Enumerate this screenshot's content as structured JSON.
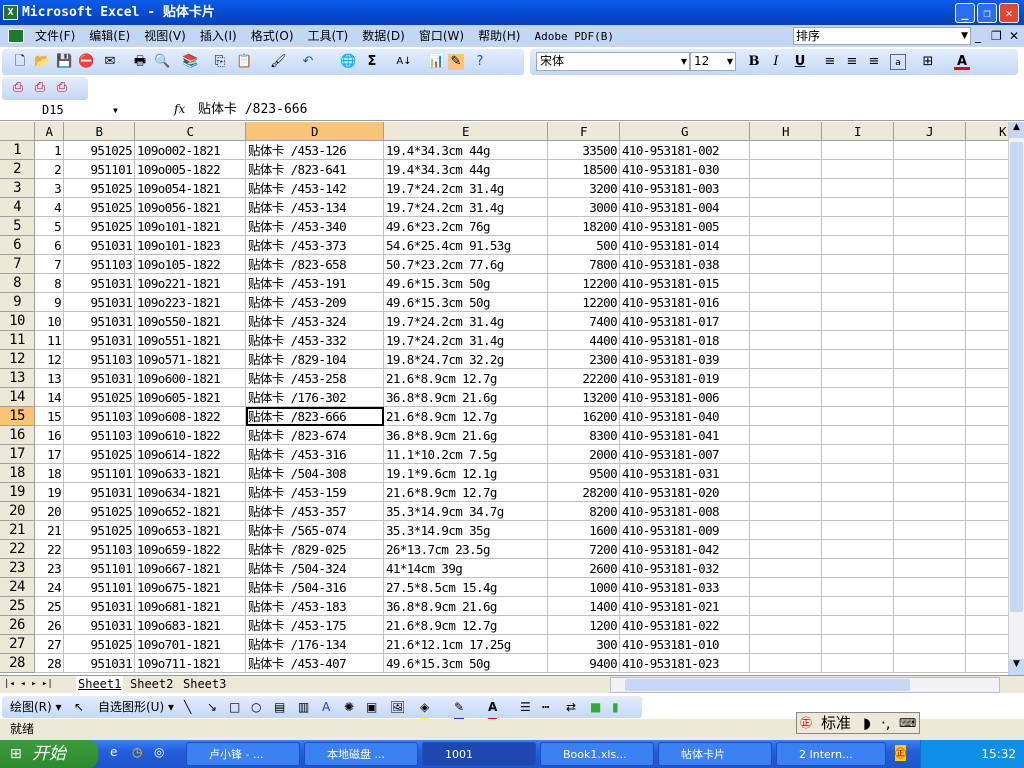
{
  "window": {
    "title": "Microsoft Excel - 贴体卡片",
    "minimize": "_",
    "restore": "❐",
    "close": "✕"
  },
  "menu": {
    "items": [
      "文件(F)",
      "编辑(E)",
      "视图(V)",
      "插入(I)",
      "格式(O)",
      "工具(T)",
      "数据(D)",
      "窗口(W)",
      "帮助(H)",
      "Adobe PDF(B)"
    ],
    "help_box": "排序"
  },
  "format_toolbar": {
    "font": "宋体",
    "size": "12",
    "bold": "B",
    "italic": "I",
    "underline": "U"
  },
  "formula_bar": {
    "name_box": "D15",
    "fx": "fx",
    "content": "贴体卡 /823-666"
  },
  "grid": {
    "columns": [
      "A",
      "B",
      "C",
      "D",
      "E",
      "F",
      "G",
      "H",
      "I",
      "J",
      "K"
    ],
    "selected_cell": "D15",
    "rows": [
      [
        "1",
        "951025",
        "109o002-1821",
        "贴体卡 /453-126",
        "19.4*34.3cm 44g",
        "33500",
        "410-953181-002"
      ],
      [
        "2",
        "951101",
        "109o005-1822",
        "贴体卡 /823-641",
        "19.4*34.3cm 44g",
        "18500",
        "410-953181-030"
      ],
      [
        "3",
        "951025",
        "109o054-1821",
        "贴体卡 /453-142",
        "19.7*24.2cm 31.4g",
        "3200",
        "410-953181-003"
      ],
      [
        "4",
        "951025",
        "109o056-1821",
        "贴体卡 /453-134",
        "19.7*24.2cm 31.4g",
        "3000",
        "410-953181-004"
      ],
      [
        "5",
        "951025",
        "109o101-1821",
        "贴体卡 /453-340",
        "49.6*23.2cm 76g",
        "18200",
        "410-953181-005"
      ],
      [
        "6",
        "951031",
        "109o101-1823",
        "贴体卡 /453-373",
        "54.6*25.4cm 91.53g",
        "500",
        "410-953181-014"
      ],
      [
        "7",
        "951103",
        "109o105-1822",
        "贴体卡 /823-658",
        "50.7*23.2cm 77.6g",
        "7800",
        "410-953181-038"
      ],
      [
        "8",
        "951031",
        "109o221-1821",
        "贴体卡 /453-191",
        "49.6*15.3cm 50g",
        "12200",
        "410-953181-015"
      ],
      [
        "9",
        "951031",
        "109o223-1821",
        "贴体卡 /453-209",
        "49.6*15.3cm 50g",
        "12200",
        "410-953181-016"
      ],
      [
        "10",
        "951031",
        "109o550-1821",
        "贴体卡 /453-324",
        "19.7*24.2cm 31.4g",
        "7400",
        "410-953181-017"
      ],
      [
        "11",
        "951031",
        "109o551-1821",
        "贴体卡 /453-332",
        "19.7*24.2cm 31.4g",
        "4400",
        "410-953181-018"
      ],
      [
        "12",
        "951103",
        "109o571-1821",
        "贴体卡 /829-104",
        "19.8*24.7cm 32.2g",
        "2300",
        "410-953181-039"
      ],
      [
        "13",
        "951031",
        "109o600-1821",
        "贴体卡 /453-258",
        "21.6*8.9cm 12.7g",
        "22200",
        "410-953181-019"
      ],
      [
        "14",
        "951025",
        "109o605-1821",
        "贴体卡 /176-302",
        "36.8*8.9cm 21.6g",
        "13200",
        "410-953181-006"
      ],
      [
        "15",
        "951103",
        "109o608-1822",
        "贴体卡 /823-666",
        "21.6*8.9cm 12.7g",
        "16200",
        "410-953181-040"
      ],
      [
        "16",
        "951103",
        "109o610-1822",
        "贴体卡 /823-674",
        "36.8*8.9cm 21.6g",
        "8300",
        "410-953181-041"
      ],
      [
        "17",
        "951025",
        "109o614-1822",
        "贴体卡 /453-316",
        "11.1*10.2cm 7.5g",
        "2000",
        "410-953181-007"
      ],
      [
        "18",
        "951101",
        "109o633-1821",
        "贴体卡 /504-308",
        "19.1*9.6cm 12.1g",
        "9500",
        "410-953181-031"
      ],
      [
        "19",
        "951031",
        "109o634-1821",
        "贴体卡 /453-159",
        "21.6*8.9cm 12.7g",
        "28200",
        "410-953181-020"
      ],
      [
        "20",
        "951025",
        "109o652-1821",
        "贴体卡 /453-357",
        "35.3*14.9cm 34.7g",
        "8200",
        "410-953181-008"
      ],
      [
        "21",
        "951025",
        "109o653-1821",
        "贴体卡 /565-074",
        "35.3*14.9cm 35g",
        "1600",
        "410-953181-009"
      ],
      [
        "22",
        "951103",
        "109o659-1822",
        "贴体卡 /829-025",
        "26*13.7cm 23.5g",
        "7200",
        "410-953181-042"
      ],
      [
        "23",
        "951101",
        "109o667-1821",
        "贴体卡 /504-324",
        "41*14cm 39g",
        "2600",
        "410-953181-032"
      ],
      [
        "24",
        "951101",
        "109o675-1821",
        "贴体卡 /504-316",
        "27.5*8.5cm 15.4g",
        "1000",
        "410-953181-033"
      ],
      [
        "25",
        "951031",
        "109o681-1821",
        "贴体卡 /453-183",
        "36.8*8.9cm 21.6g",
        "1400",
        "410-953181-021"
      ],
      [
        "26",
        "951031",
        "109o683-1821",
        "贴体卡 /453-175",
        "21.6*8.9cm 12.7g",
        "1200",
        "410-953181-022"
      ],
      [
        "27",
        "951025",
        "109o701-1821",
        "贴体卡 /176-134",
        "21.6*12.1cm 17.25g",
        "300",
        "410-953181-010"
      ],
      [
        "28",
        "951031",
        "109o711-1821",
        "贴体卡 /453-407",
        "49.6*15.3cm 50g",
        "9400",
        "410-953181-023"
      ]
    ]
  },
  "sheets": [
    "Sheet1",
    "Sheet2",
    "Sheet3"
  ],
  "draw_toolbar": {
    "draw": "绘图(R) ▾",
    "autoshapes": "自选图形(U) ▾"
  },
  "status": "就绪",
  "ime": {
    "mode": "标准"
  },
  "taskbar": {
    "start": "开始",
    "tasks": [
      "卢小锋 - ...",
      "本地磁盘 ...",
      "1001",
      "Book1.xls...",
      "帖体卡片",
      "2 Intern..."
    ],
    "clock": "15:32"
  }
}
